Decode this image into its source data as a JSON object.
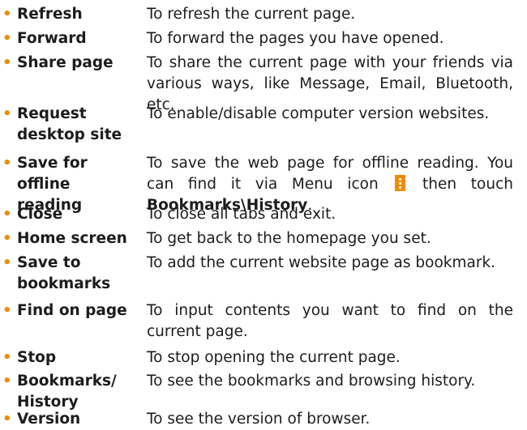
{
  "bullet": "•",
  "items": [
    {
      "term": "Refresh",
      "desc": "To refresh the current page."
    },
    {
      "term": "Forward",
      "desc": "To forward the pages you have opened."
    },
    {
      "term": "Share page",
      "desc": "To share the current page with your friends via various ways, like Message, Email, Bluetooth, etc."
    },
    {
      "term": "Request\ndesktop site",
      "desc": "To enable/disable computer version websites."
    },
    {
      "term": "Save for\noffline reading",
      "desc_before": "To save the web page for offline reading. You can find it via Menu icon",
      "desc_after": "then touch",
      "desc_path": "Bookmarks\\History",
      "desc_end": "."
    },
    {
      "term": "Close",
      "desc": "To close all tabs and exit."
    },
    {
      "term": "Home screen",
      "desc": "To get back to the homepage you set."
    },
    {
      "term": "Save to\nbookmarks",
      "desc": "To add the current website page as bookmark."
    },
    {
      "term": "Find on page",
      "desc": "To input contents you want to find on the current page."
    },
    {
      "term": "Stop",
      "desc": "To stop opening the current page."
    },
    {
      "term": "Bookmarks/\nHistory",
      "desc": "To see the bookmarks and browsing history."
    },
    {
      "term": "Version",
      "desc": "To see the version of browser."
    }
  ],
  "colors": {
    "bullet": "#f08c00",
    "text": "#1c1c1c",
    "icon": "#f08c00"
  },
  "icons": {
    "menu": "menu-dots-icon"
  }
}
